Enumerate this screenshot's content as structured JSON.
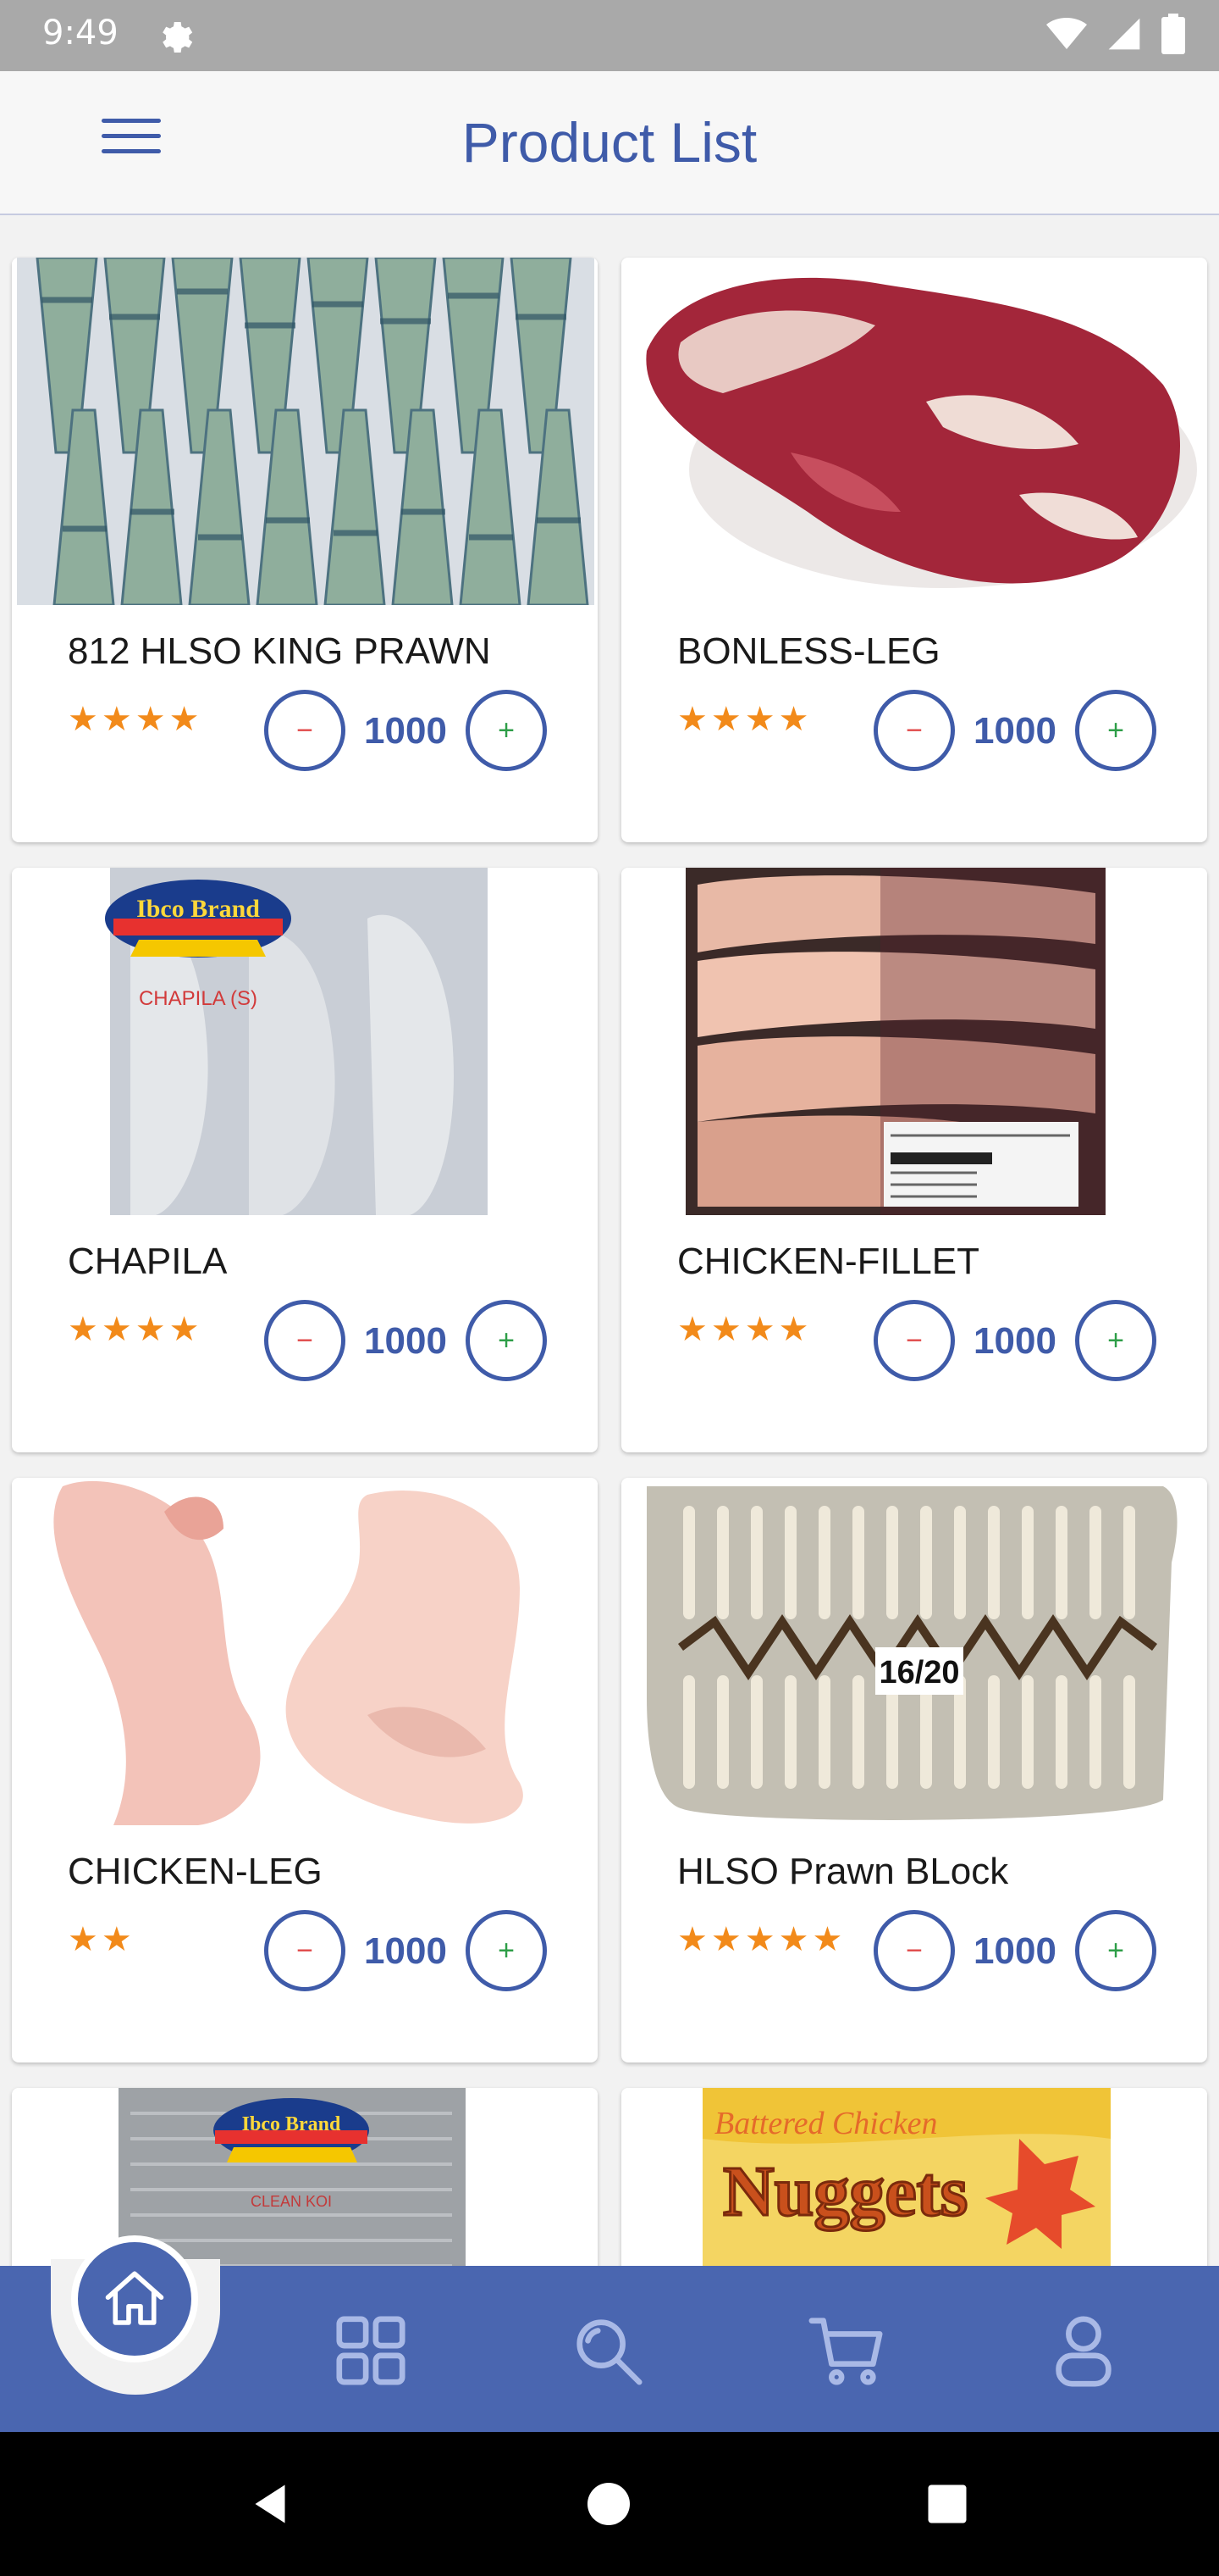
{
  "status_bar": {
    "time": "9:49"
  },
  "header": {
    "title": "Product List"
  },
  "icons": {
    "menu": "menu-icon",
    "settings": "gear-icon",
    "wifi": "wifi-icon",
    "signal": "signal-icon",
    "battery": "battery-icon",
    "home": "home-icon",
    "categories": "grid-icon",
    "search": "search-icon",
    "cart": "cart-icon",
    "profile": "user-icon"
  },
  "products": [
    {
      "name": "812 HLSO KING PRAWN",
      "stars": "★★★★",
      "qty": "1000",
      "minus": "−",
      "plus": "+"
    },
    {
      "name": "BONLESS-LEG",
      "stars": "★★★★",
      "qty": "1000",
      "minus": "−",
      "plus": "+"
    },
    {
      "name": "CHAPILA",
      "stars": "★★★★",
      "qty": "1000",
      "minus": "−",
      "plus": "+"
    },
    {
      "name": "CHICKEN-FILLET",
      "stars": "★★★★",
      "qty": "1000",
      "minus": "−",
      "plus": "+"
    },
    {
      "name": "CHICKEN-LEG",
      "stars": "★★",
      "qty": "1000",
      "minus": "−",
      "plus": "+"
    },
    {
      "name": "HLSO Prawn BLock",
      "stars": "★★★★★",
      "qty": "1000",
      "minus": "−",
      "plus": "+"
    },
    {
      "name": "",
      "stars": "",
      "qty": "",
      "minus": "",
      "plus": ""
    },
    {
      "name": "",
      "stars": "",
      "qty": "",
      "minus": "",
      "plus": ""
    }
  ],
  "product_images": [
    {
      "brand": "",
      "label": ""
    },
    {
      "brand": "",
      "label": ""
    },
    {
      "brand": "Ibco Brand",
      "label": "CHAPILA (S)"
    },
    {
      "brand": "",
      "label": ""
    },
    {
      "brand": "",
      "label": ""
    },
    {
      "brand": "",
      "label": "16/20"
    },
    {
      "brand": "Ibco Brand",
      "label": "CLEAN KOI"
    },
    {
      "brand": "Battered Chicken",
      "label": "Nuggets"
    }
  ],
  "colors": {
    "primary": "#3f5ba9",
    "star": "#f28a1a",
    "minus": "#e04848",
    "plus": "#2e9e48"
  }
}
